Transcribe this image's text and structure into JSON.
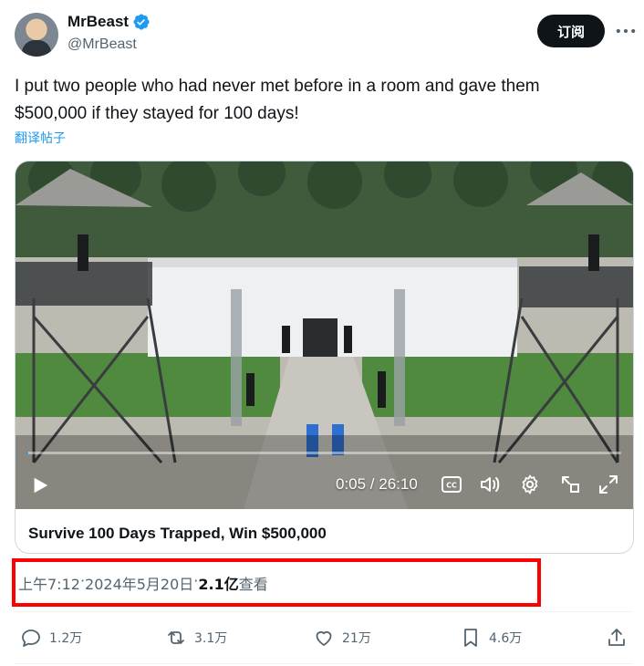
{
  "author": {
    "display_name": "MrBeast",
    "handle": "@MrBeast",
    "verified": true
  },
  "header": {
    "subscribe_label": "订阅",
    "more_icon": "more-horizontal-icon"
  },
  "tweet": {
    "text": "I put two people who had never met before in a room and gave them $500,000 if they stayed for 100 days!",
    "translate_label": "翻译帖子"
  },
  "video": {
    "time": "0:05 / 26:10",
    "progress_fraction": 0.003,
    "card_title": "Survive 100 Days Trapped, Win $500,000"
  },
  "meta": {
    "time": "上午7:12",
    "date": "2024年5月20日",
    "separator": " · ",
    "views": "2.1亿",
    "views_label": " 查看"
  },
  "actions": {
    "replies": "1.2万",
    "reposts": "3.1万",
    "likes": "21万",
    "bookmarks": "4.6万"
  },
  "colors": {
    "accent": "#1d9bf0",
    "highlight_box": "#ff0000",
    "secondary_text": "#536471"
  }
}
